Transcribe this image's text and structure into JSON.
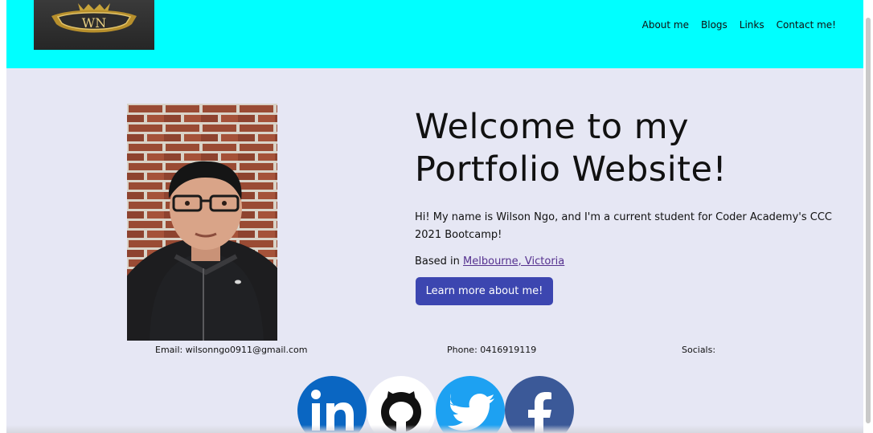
{
  "header": {
    "logo_text": "WN",
    "nav": [
      "About me",
      "Blogs",
      "Links",
      "Contact me!"
    ]
  },
  "hero": {
    "title_line1": "Welcome to my",
    "title_line2": "Portfolio Website!",
    "intro": "Hi! My name is Wilson Ngo, and I'm a current student for Coder Academy's CCC 2021 Bootcamp!",
    "location_prefix": "Based in ",
    "location_link": "Melbourne, Victoria",
    "cta_label": "Learn more about me!"
  },
  "contact": {
    "email": "Email: wilsonngo0911@gmail.com",
    "phone": "Phone: 0416919119",
    "socials_label": "Socials:"
  },
  "socials": [
    "linkedin-icon",
    "github-icon",
    "twitter-icon",
    "facebook-icon"
  ],
  "colors": {
    "header_bg": "#00ffff",
    "page_bg": "#e6e7f4",
    "button": "#3c46b0",
    "link": "#55318f",
    "linkedin": "#0a66c2",
    "twitter": "#1da1f2",
    "facebook": "#3b5998"
  }
}
